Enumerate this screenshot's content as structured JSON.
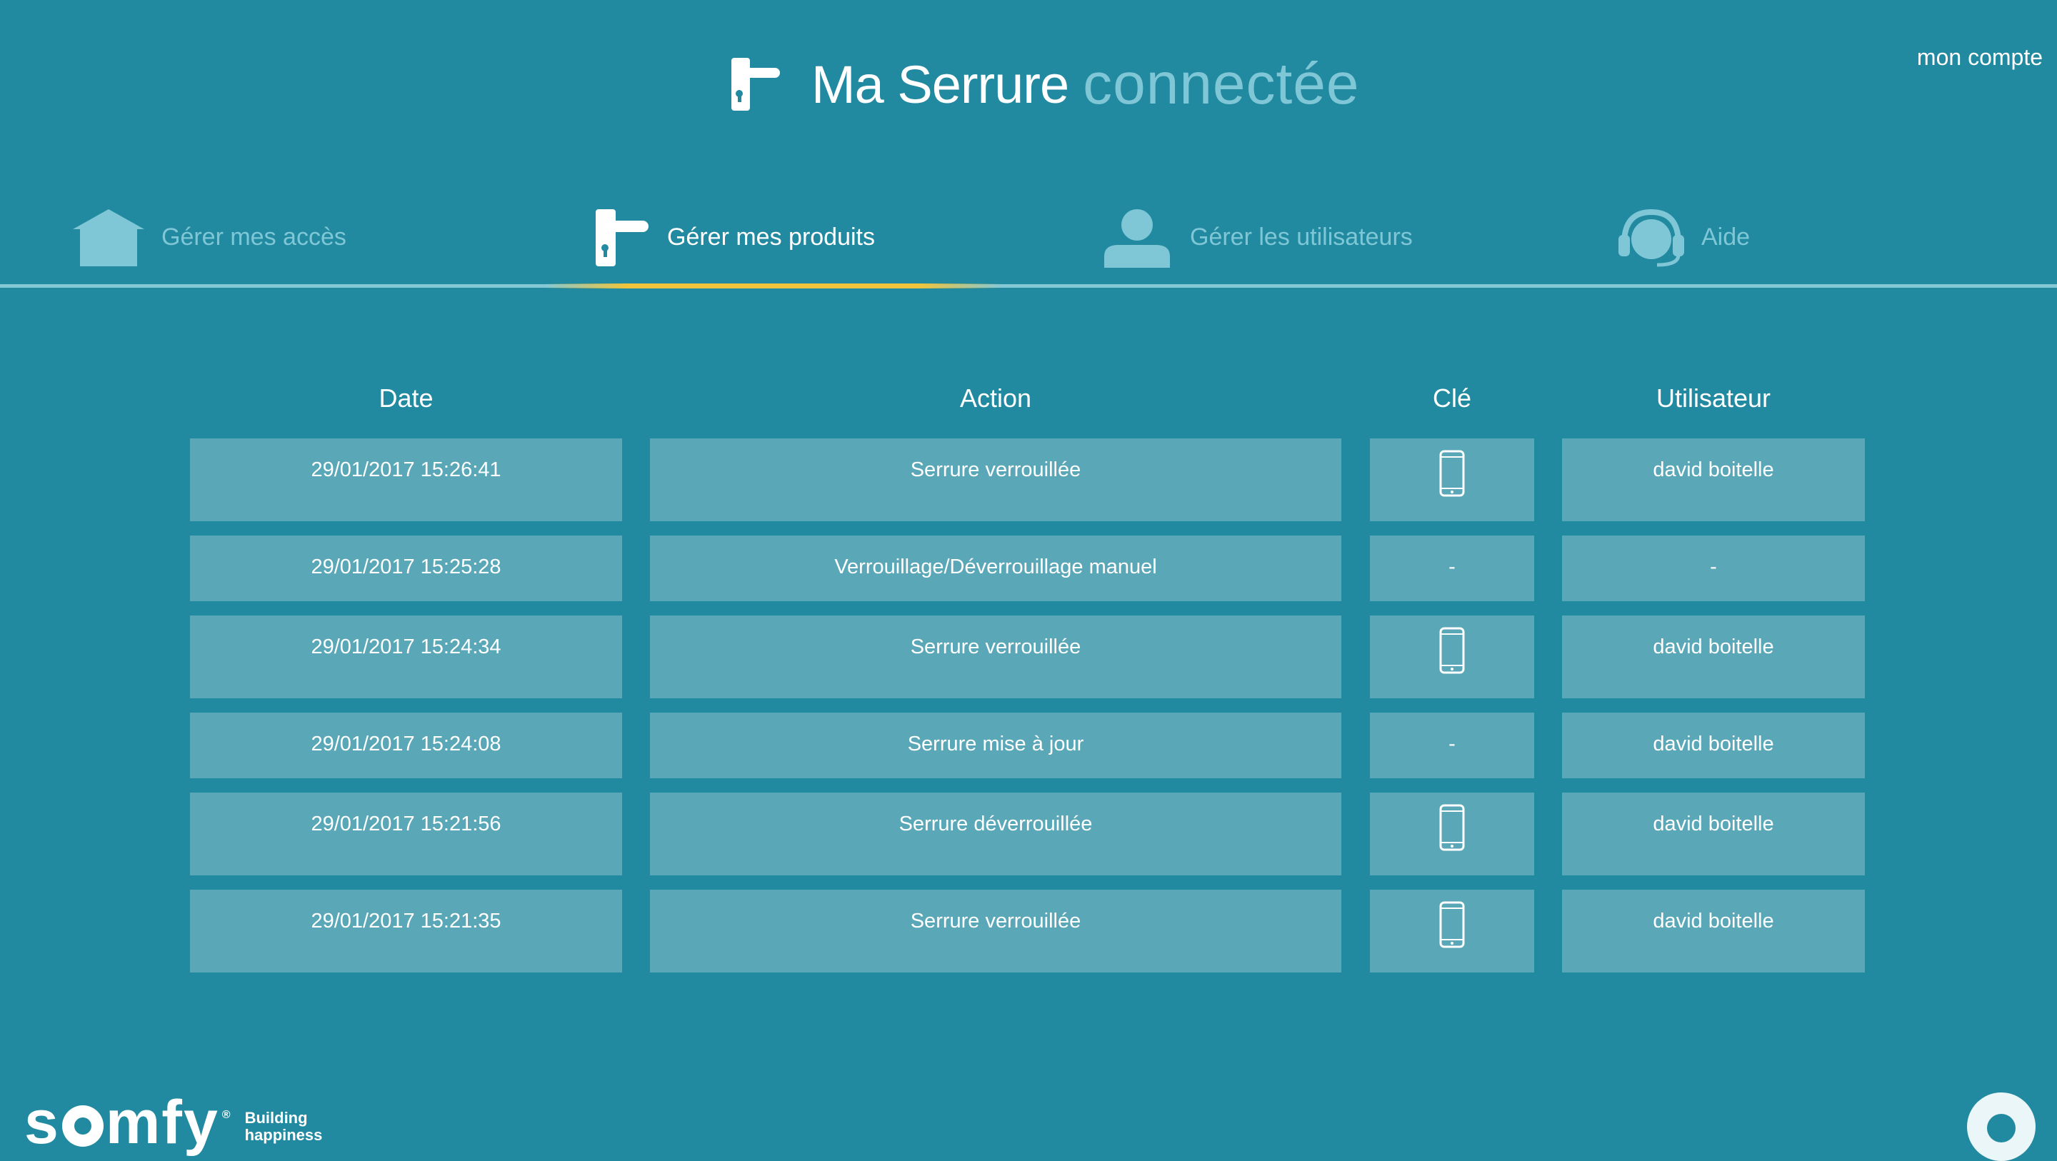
{
  "app": {
    "title_strong": "Ma Serrure",
    "title_light": "connectée",
    "account_link": "mon compte"
  },
  "tabs": [
    {
      "label": "Gérer mes accès",
      "icon": "house-icon",
      "active": false
    },
    {
      "label": "Gérer mes produits",
      "icon": "door-handle-icon",
      "active": true
    },
    {
      "label": "Gérer les utilisateurs",
      "icon": "user-icon",
      "active": false
    },
    {
      "label": "Aide",
      "icon": "headset-icon",
      "active": false
    }
  ],
  "table": {
    "headers": {
      "date": "Date",
      "action": "Action",
      "key": "Clé",
      "user": "Utilisateur"
    },
    "rows": [
      {
        "date": "29/01/2017 15:26:41",
        "action": "Serrure verrouillée",
        "key": "phone-icon",
        "key_text": "",
        "user": "david boitelle"
      },
      {
        "date": "29/01/2017 15:25:28",
        "action": "Verrouillage/Déverrouillage manuel",
        "key": "none",
        "key_text": "-",
        "user": "-"
      },
      {
        "date": "29/01/2017 15:24:34",
        "action": "Serrure verrouillée",
        "key": "phone-icon",
        "key_text": "",
        "user": "david boitelle"
      },
      {
        "date": "29/01/2017 15:24:08",
        "action": "Serrure mise à jour",
        "key": "none",
        "key_text": "-",
        "user": "david boitelle"
      },
      {
        "date": "29/01/2017 15:21:56",
        "action": "Serrure déverrouillée",
        "key": "phone-icon",
        "key_text": "",
        "user": "david boitelle"
      },
      {
        "date": "29/01/2017 15:21:35",
        "action": "Serrure verrouillée",
        "key": "phone-icon",
        "key_text": "",
        "user": "david boitelle"
      }
    ]
  },
  "footer": {
    "logo_s": "s",
    "logo_rest": "mfy",
    "logo_reg": "®",
    "tagline_1": "Building",
    "tagline_2": "happiness"
  },
  "colors": {
    "background": "#228aa0",
    "cell": "#5aa7b7",
    "inactive_text": "#7fc7d6",
    "accent_underline": "#f0c43c"
  }
}
